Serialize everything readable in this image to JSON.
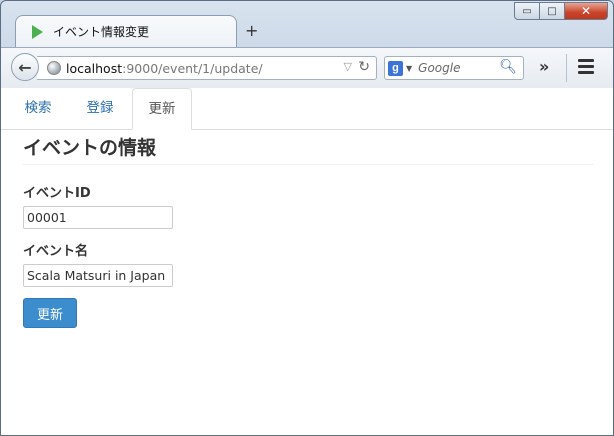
{
  "browser": {
    "tab_title": "イベント情報変更",
    "new_tab": "+",
    "url_host": "localhost",
    "url_path": ":9000/event/1/update/",
    "search_placeholder": "Google",
    "search_engine_letter": "g",
    "window_controls": {
      "minimize": "▭",
      "maximize": "□",
      "close": "✕"
    },
    "icons": {
      "back": "back-arrow-icon",
      "reload": "reload-icon",
      "search": "magnifier-icon",
      "overflow": "double-chevron-icon",
      "menu": "hamburger-menu-icon"
    },
    "overflow_label": "»",
    "reload_glyph": "↻",
    "back_glyph": "←",
    "dropdown_glyph": "▽",
    "search_glyph": "⚲"
  },
  "nav": {
    "items": [
      {
        "label": "検索",
        "active": false
      },
      {
        "label": "登録",
        "active": false
      },
      {
        "label": "更新",
        "active": true
      }
    ]
  },
  "form": {
    "heading": "イベントの情報",
    "fields": [
      {
        "label": "イベントID",
        "value": "00001"
      },
      {
        "label": "イベント名",
        "value": "Scala Matsuri in Japan"
      }
    ],
    "submit_label": "更新"
  },
  "colors": {
    "link": "#2a6fb0",
    "button": "#3c8dcd"
  }
}
